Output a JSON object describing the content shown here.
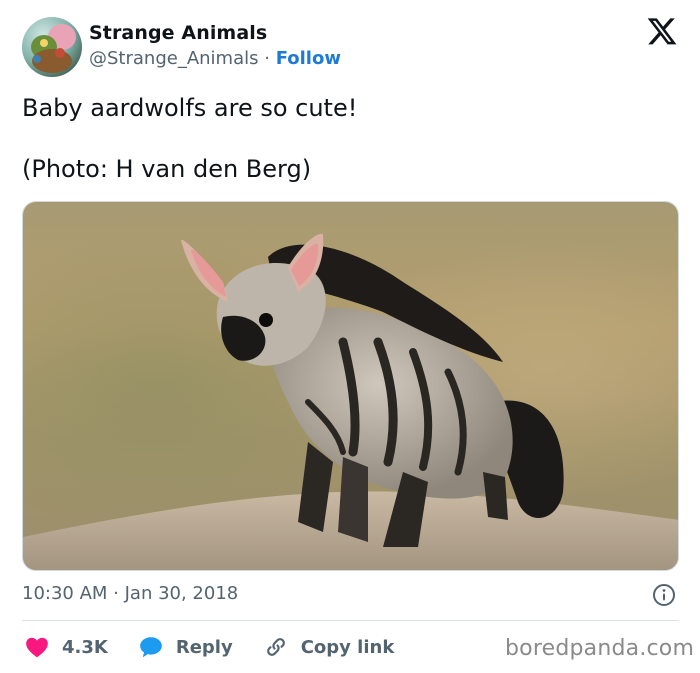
{
  "author": {
    "name": "Strange Animals",
    "handle": "@Strange_Animals",
    "separator": "·",
    "follow_label": "Follow"
  },
  "tweet": {
    "line1": "Baby aardwolfs are so cute!",
    "line2": "(Photo: H van den Berg)",
    "timestamp": "10:30 AM · Jan 30, 2018"
  },
  "actions": {
    "likes_count": "4.3K",
    "reply_label": "Reply",
    "copy_label": "Copy link"
  },
  "watermark": "boredpanda.com",
  "icons": {
    "brand": "x-logo-icon",
    "like": "heart-icon",
    "reply": "speech-bubble-icon",
    "copy": "link-icon",
    "info": "info-icon"
  },
  "colors": {
    "follow": "#1d7bd8",
    "heart": "#f91880",
    "reply_bubble": "#1d9bf0",
    "muted_text": "#536471"
  }
}
